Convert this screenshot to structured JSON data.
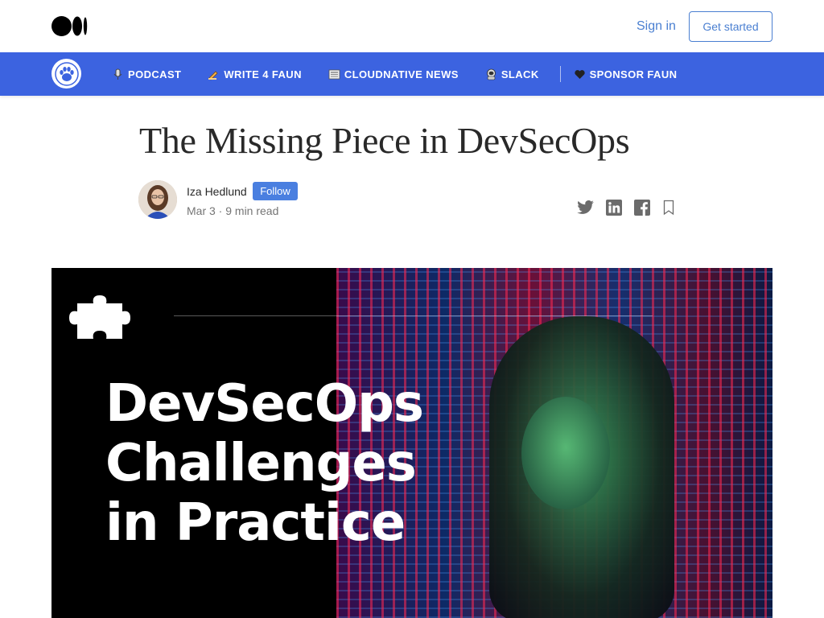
{
  "topbar": {
    "logo_icon": "medium-logo-icon",
    "signin_label": "Sign in",
    "getstarted_label": "Get started"
  },
  "nav": {
    "logo_icon": "faun-paw-icon",
    "items": [
      {
        "icon": "microphone-icon",
        "label": "PODCAST"
      },
      {
        "icon": "writing-hand-icon",
        "label": "WRITE 4 FAUN"
      },
      {
        "icon": "newspaper-icon",
        "label": "CLOUDNATIVE NEWS"
      },
      {
        "icon": "astronaut-icon",
        "label": "SLACK"
      },
      {
        "icon": "heart-icon",
        "label": "SPONSOR FAUN"
      }
    ]
  },
  "article": {
    "title": "The Missing Piece in DevSecOps",
    "author": "Iza Hedlund",
    "follow_label": "Follow",
    "meta": "Mar 3 · 9 min read",
    "share_icons": [
      "twitter-icon",
      "linkedin-icon",
      "facebook-icon",
      "bookmark-icon"
    ]
  },
  "hero": {
    "line1": "DevSecOps",
    "line2": "Challenges",
    "line3": "in Practice"
  },
  "colors": {
    "nav_bg": "#3c63e0",
    "link": "#4a7fd1",
    "follow_bg": "#4a7fe0"
  }
}
